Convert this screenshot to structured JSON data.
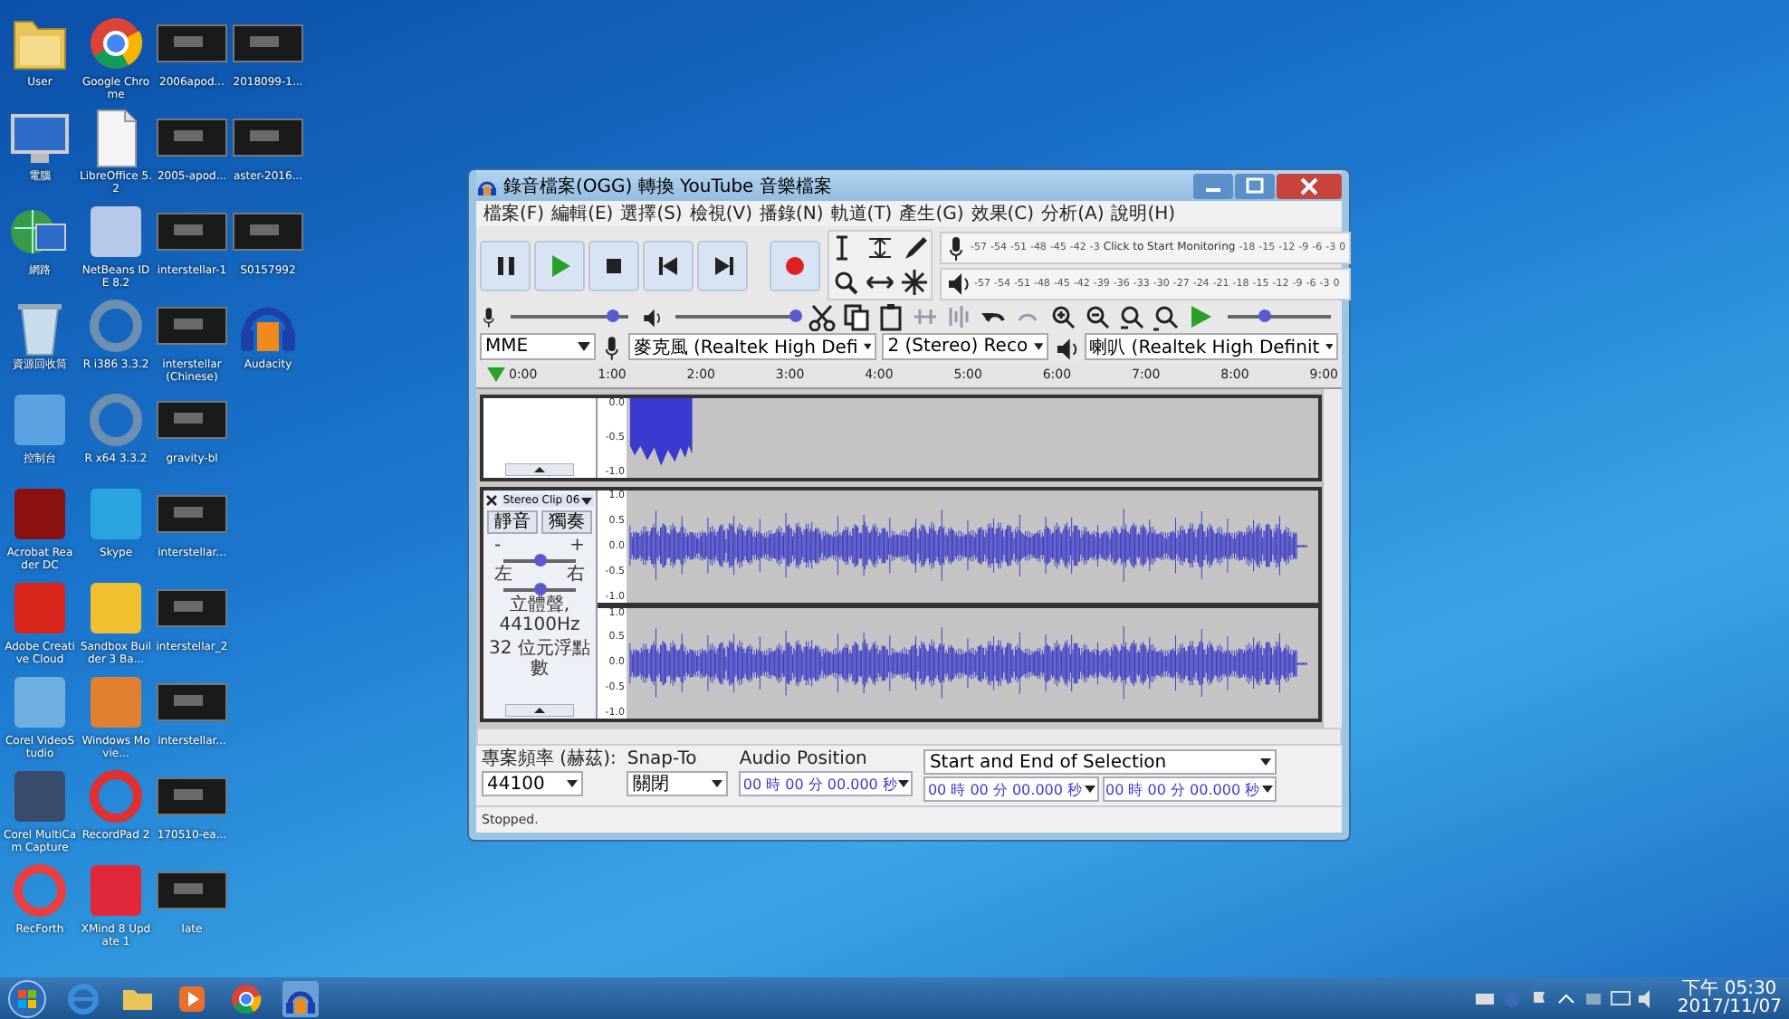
{
  "desktop_icons": [
    {
      "label": "User",
      "kind": "folder"
    },
    {
      "label": "電腦",
      "kind": "monitor"
    },
    {
      "label": "網路",
      "kind": "globe"
    },
    {
      "label": "資源回收筒",
      "kind": "bin"
    },
    {
      "label": "控制台",
      "kind": "tile",
      "color": "#5ba3e0"
    },
    {
      "label": "Acrobat Reader DC",
      "kind": "tile",
      "color": "#8b1010"
    },
    {
      "label": "Adobe Creative Cloud",
      "kind": "tile",
      "color": "#d9261c"
    },
    {
      "label": "Corel VideoStudio",
      "kind": "tile",
      "color": "#6fb0e0"
    },
    {
      "label": "Corel MultiCam Capture",
      "kind": "tile",
      "color": "#3a4a6a"
    },
    {
      "label": "RecForth",
      "kind": "ring",
      "color": "#e84040"
    },
    {
      "label": "Google Chrome",
      "kind": "chrome"
    },
    {
      "label": "LibreOffice 5.2",
      "kind": "document"
    },
    {
      "label": "NetBeans IDE 8.2",
      "kind": "tile",
      "color": "#b8c8e8"
    },
    {
      "label": "R i386 3.3.2",
      "kind": "ring",
      "color": "#6f8fb0"
    },
    {
      "label": "R x64 3.3.2",
      "kind": "ring",
      "color": "#6f8fb0"
    },
    {
      "label": "Skype",
      "kind": "tile",
      "color": "#2aa5e0"
    },
    {
      "label": "Sandbox Builder 3 Ba...",
      "kind": "tile",
      "color": "#f0c030"
    },
    {
      "label": "Windows Movie...",
      "kind": "tile",
      "color": "#e08030"
    },
    {
      "label": "RecordPad 2",
      "kind": "ring",
      "color": "#e03030"
    },
    {
      "label": "XMind 8 Update 1",
      "kind": "tile",
      "color": "#e0283a"
    },
    {
      "label": "2006apod...",
      "kind": "photo"
    },
    {
      "label": "2005-apod...",
      "kind": "photo"
    },
    {
      "label": "interstellar-1",
      "kind": "photo"
    },
    {
      "label": "interstellar (Chinese)",
      "kind": "photo"
    },
    {
      "label": "gravity-bl",
      "kind": "photo"
    },
    {
      "label": "interstellar...",
      "kind": "photo"
    },
    {
      "label": "interstellar_2",
      "kind": "photo"
    },
    {
      "label": "interstellar...",
      "kind": "photo"
    },
    {
      "label": "170510-ea...",
      "kind": "photo"
    },
    {
      "label": "late",
      "kind": "photo"
    },
    {
      "label": "2018099-1...",
      "kind": "photo"
    },
    {
      "label": "aster-2016...",
      "kind": "photo"
    },
    {
      "label": "S0157992",
      "kind": "photo"
    },
    {
      "label": "Audacity",
      "kind": "headphones"
    }
  ],
  "window": {
    "title": "錄音檔案(OGG) 轉換 YouTube 音樂檔案",
    "menu": [
      "檔案(F)",
      "編輯(E)",
      "選擇(S)",
      "檢視(V)",
      "播錄(N)",
      "軌道(T)",
      "產生(G)",
      "效果(C)",
      "分析(A)",
      "說明(H)"
    ],
    "record_meter": {
      "scale_before": [
        "-57",
        "-54",
        "-51",
        "-48",
        "-45",
        "-42",
        "-3"
      ],
      "label": "Click to Start Monitoring",
      "scale_after": [
        "-18",
        "-15",
        "-12",
        "-9",
        "-6",
        "-3",
        "0"
      ]
    },
    "playback_meter": {
      "scale": [
        "-57",
        "-54",
        "-51",
        "-48",
        "-45",
        "-42",
        "-39",
        "-36",
        "-33",
        "-30",
        "-27",
        "-24",
        "-21",
        "-18",
        "-15",
        "-12",
        "-9",
        "-6",
        "-3",
        "0"
      ]
    },
    "mic_volume": {
      "level": 0.85
    },
    "speaker_volume": {
      "level": 1.0
    },
    "play_speed": {
      "level": 0.35
    },
    "devices": {
      "host": "MME",
      "input": "麥克風 (Realtek High Defi",
      "channels": "2 (Stereo) Reco",
      "output": "喇叭 (Realtek High Definit"
    },
    "ruler": [
      "0:00",
      "1:00",
      "2:00",
      "3:00",
      "4:00",
      "5:00",
      "6:00",
      "7:00",
      "8:00",
      "9:00"
    ],
    "tracks": [
      {
        "kind": "partial",
        "axis": [
          "0.0",
          "-0.5",
          "-1.0"
        ]
      },
      {
        "kind": "stereo",
        "name": "Stereo Clip 06",
        "mute": "靜音",
        "solo": "獨奏",
        "gain": {
          "minus": "-",
          "plus": "+",
          "level": 0.5
        },
        "pan": {
          "left": "左",
          "right": "右",
          "level": 0.5
        },
        "info": [
          "立體聲, 44100Hz",
          "32 位元浮點數"
        ],
        "channels": [
          {
            "axis": [
              "1.0",
              "0.5",
              "0.0",
              "-0.5",
              "-1.0"
            ]
          },
          {
            "axis": [
              "1.0",
              "0.5",
              "0.0",
              "-0.5",
              "-1.0"
            ]
          }
        ]
      }
    ],
    "selection_bar": {
      "rate_label": "專案頻率 (赫茲):",
      "rate": "44100",
      "snap_label": "Snap-To",
      "snap": "關閉",
      "position_label": "Audio Position",
      "position": "00 時 00 分 00.000 秒",
      "selection_label": "Start and End of Selection",
      "start": "00 時 00 分 00.000 秒",
      "end": "00 時 00 分 00.000 秒"
    },
    "status": "Stopped."
  },
  "taskbar": {
    "clock_time": "下午 05:30",
    "clock_date": "2017/11/07"
  }
}
